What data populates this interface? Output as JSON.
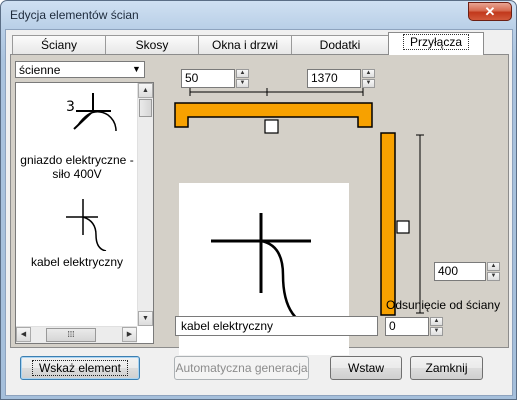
{
  "window": {
    "title": "Edycja elementów ścian",
    "close_label": "✕"
  },
  "tabs": [
    {
      "label": "Ściany"
    },
    {
      "label": "Skosy"
    },
    {
      "label": "Okna i drzwi"
    },
    {
      "label": "Dodatki"
    },
    {
      "label": "Przyłącza"
    }
  ],
  "category_select": {
    "value": "ścienne"
  },
  "list": {
    "items": [
      {
        "label": "gniazdo elektryczne - siło 400V",
        "icon": "socket-symbol-icon"
      },
      {
        "label": "kabel elektryczny",
        "icon": "cable-symbol-icon"
      }
    ]
  },
  "dims": {
    "left_offset": "50",
    "right_offset": "1370",
    "height": "400",
    "wall_offset": "0"
  },
  "labels": {
    "wall_offset_label": "Odsunięcie od ściany"
  },
  "element_name": "kabel elektryczny",
  "buttons": {
    "select": "Wskaż element",
    "autogen": "Automatyczna generacja",
    "insert": "Wstaw",
    "close": "Zamknij"
  },
  "colors": {
    "wall": "#f7a100",
    "accent": "#3c7fb1"
  }
}
